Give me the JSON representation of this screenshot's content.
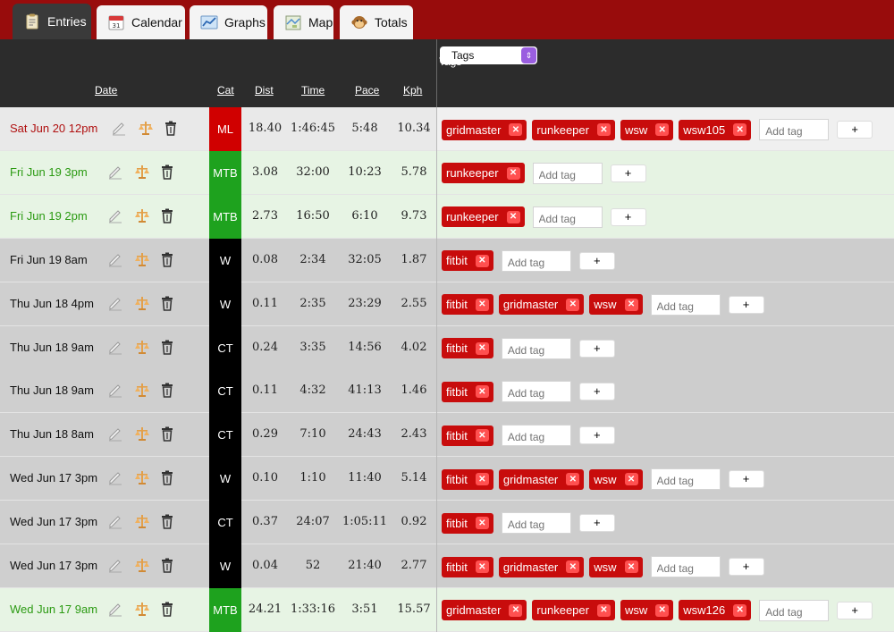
{
  "tabs": [
    {
      "label": "Entries",
      "icon": "clipboard-icon",
      "active": true
    },
    {
      "label": "Calendar",
      "icon": "calendar-icon",
      "active": false
    },
    {
      "label": "Graphs",
      "icon": "graph-icon",
      "active": false
    },
    {
      "label": "Map",
      "icon": "map-icon",
      "active": false
    },
    {
      "label": "Totals",
      "icon": "monkey-icon",
      "active": false
    }
  ],
  "header": {
    "date": "Date",
    "cat": "Cat",
    "dist": "Dist",
    "time": "Time",
    "pace": "Pace",
    "kph": "Kph",
    "tags": "Tags",
    "tag_select": "Tags",
    "tag_select_arrows": "⇕"
  },
  "add_tag_placeholder": "Add tag",
  "add_button": "+",
  "remove_glyph": "✕",
  "category_colors": {
    "ML": "#d00000",
    "MTB": "#1ea21e",
    "W": "#000000",
    "CT": "#000000"
  },
  "rows": [
    {
      "date": "Sat Jun 20 12pm",
      "cat": "ML",
      "dist": "18.40",
      "time": "1:46:45",
      "pace": "5:48",
      "kph": "10.34",
      "tags": [
        "gridmaster",
        "runkeeper",
        "wsw",
        "wsw105"
      ]
    },
    {
      "date": "Fri Jun 19 3pm",
      "cat": "MTB",
      "dist": "3.08",
      "time": "32:00",
      "pace": "10:23",
      "kph": "5.78",
      "tags": [
        "runkeeper"
      ]
    },
    {
      "date": "Fri Jun 19 2pm",
      "cat": "MTB",
      "dist": "2.73",
      "time": "16:50",
      "pace": "6:10",
      "kph": "9.73",
      "tags": [
        "runkeeper"
      ]
    },
    {
      "date": "Fri Jun 19 8am",
      "cat": "W",
      "dist": "0.08",
      "time": "2:34",
      "pace": "32:05",
      "kph": "1.87",
      "tags": [
        "fitbit"
      ]
    },
    {
      "date": "Thu Jun 18 4pm",
      "cat": "W",
      "dist": "0.11",
      "time": "2:35",
      "pace": "23:29",
      "kph": "2.55",
      "tags": [
        "fitbit",
        "gridmaster",
        "wsw"
      ]
    },
    {
      "date": "Thu Jun 18 9am",
      "cat": "CT",
      "dist": "0.24",
      "time": "3:35",
      "pace": "14:56",
      "kph": "4.02",
      "tags": [
        "fitbit"
      ]
    },
    {
      "date": "Thu Jun 18 9am",
      "cat": "CT",
      "dist": "0.11",
      "time": "4:32",
      "pace": "41:13",
      "kph": "1.46",
      "tags": [
        "fitbit"
      ]
    },
    {
      "date": "Thu Jun 18 8am",
      "cat": "CT",
      "dist": "0.29",
      "time": "7:10",
      "pace": "24:43",
      "kph": "2.43",
      "tags": [
        "fitbit"
      ]
    },
    {
      "date": "Wed Jun 17 3pm",
      "cat": "W",
      "dist": "0.10",
      "time": "1:10",
      "pace": "11:40",
      "kph": "5.14",
      "tags": [
        "fitbit",
        "gridmaster",
        "wsw"
      ]
    },
    {
      "date": "Wed Jun 17 3pm",
      "cat": "CT",
      "dist": "0.37",
      "time": "24:07",
      "pace": "1:05:11",
      "kph": "0.92",
      "tags": [
        "fitbit"
      ]
    },
    {
      "date": "Wed Jun 17 3pm",
      "cat": "W",
      "dist": "0.04",
      "time": "52",
      "pace": "21:40",
      "kph": "2.77",
      "tags": [
        "fitbit",
        "gridmaster",
        "wsw"
      ]
    },
    {
      "date": "Wed Jun 17 9am",
      "cat": "MTB",
      "dist": "24.21",
      "time": "1:33:16",
      "pace": "3:51",
      "kph": "15.57",
      "tags": [
        "gridmaster",
        "runkeeper",
        "wsw",
        "wsw126"
      ]
    }
  ]
}
